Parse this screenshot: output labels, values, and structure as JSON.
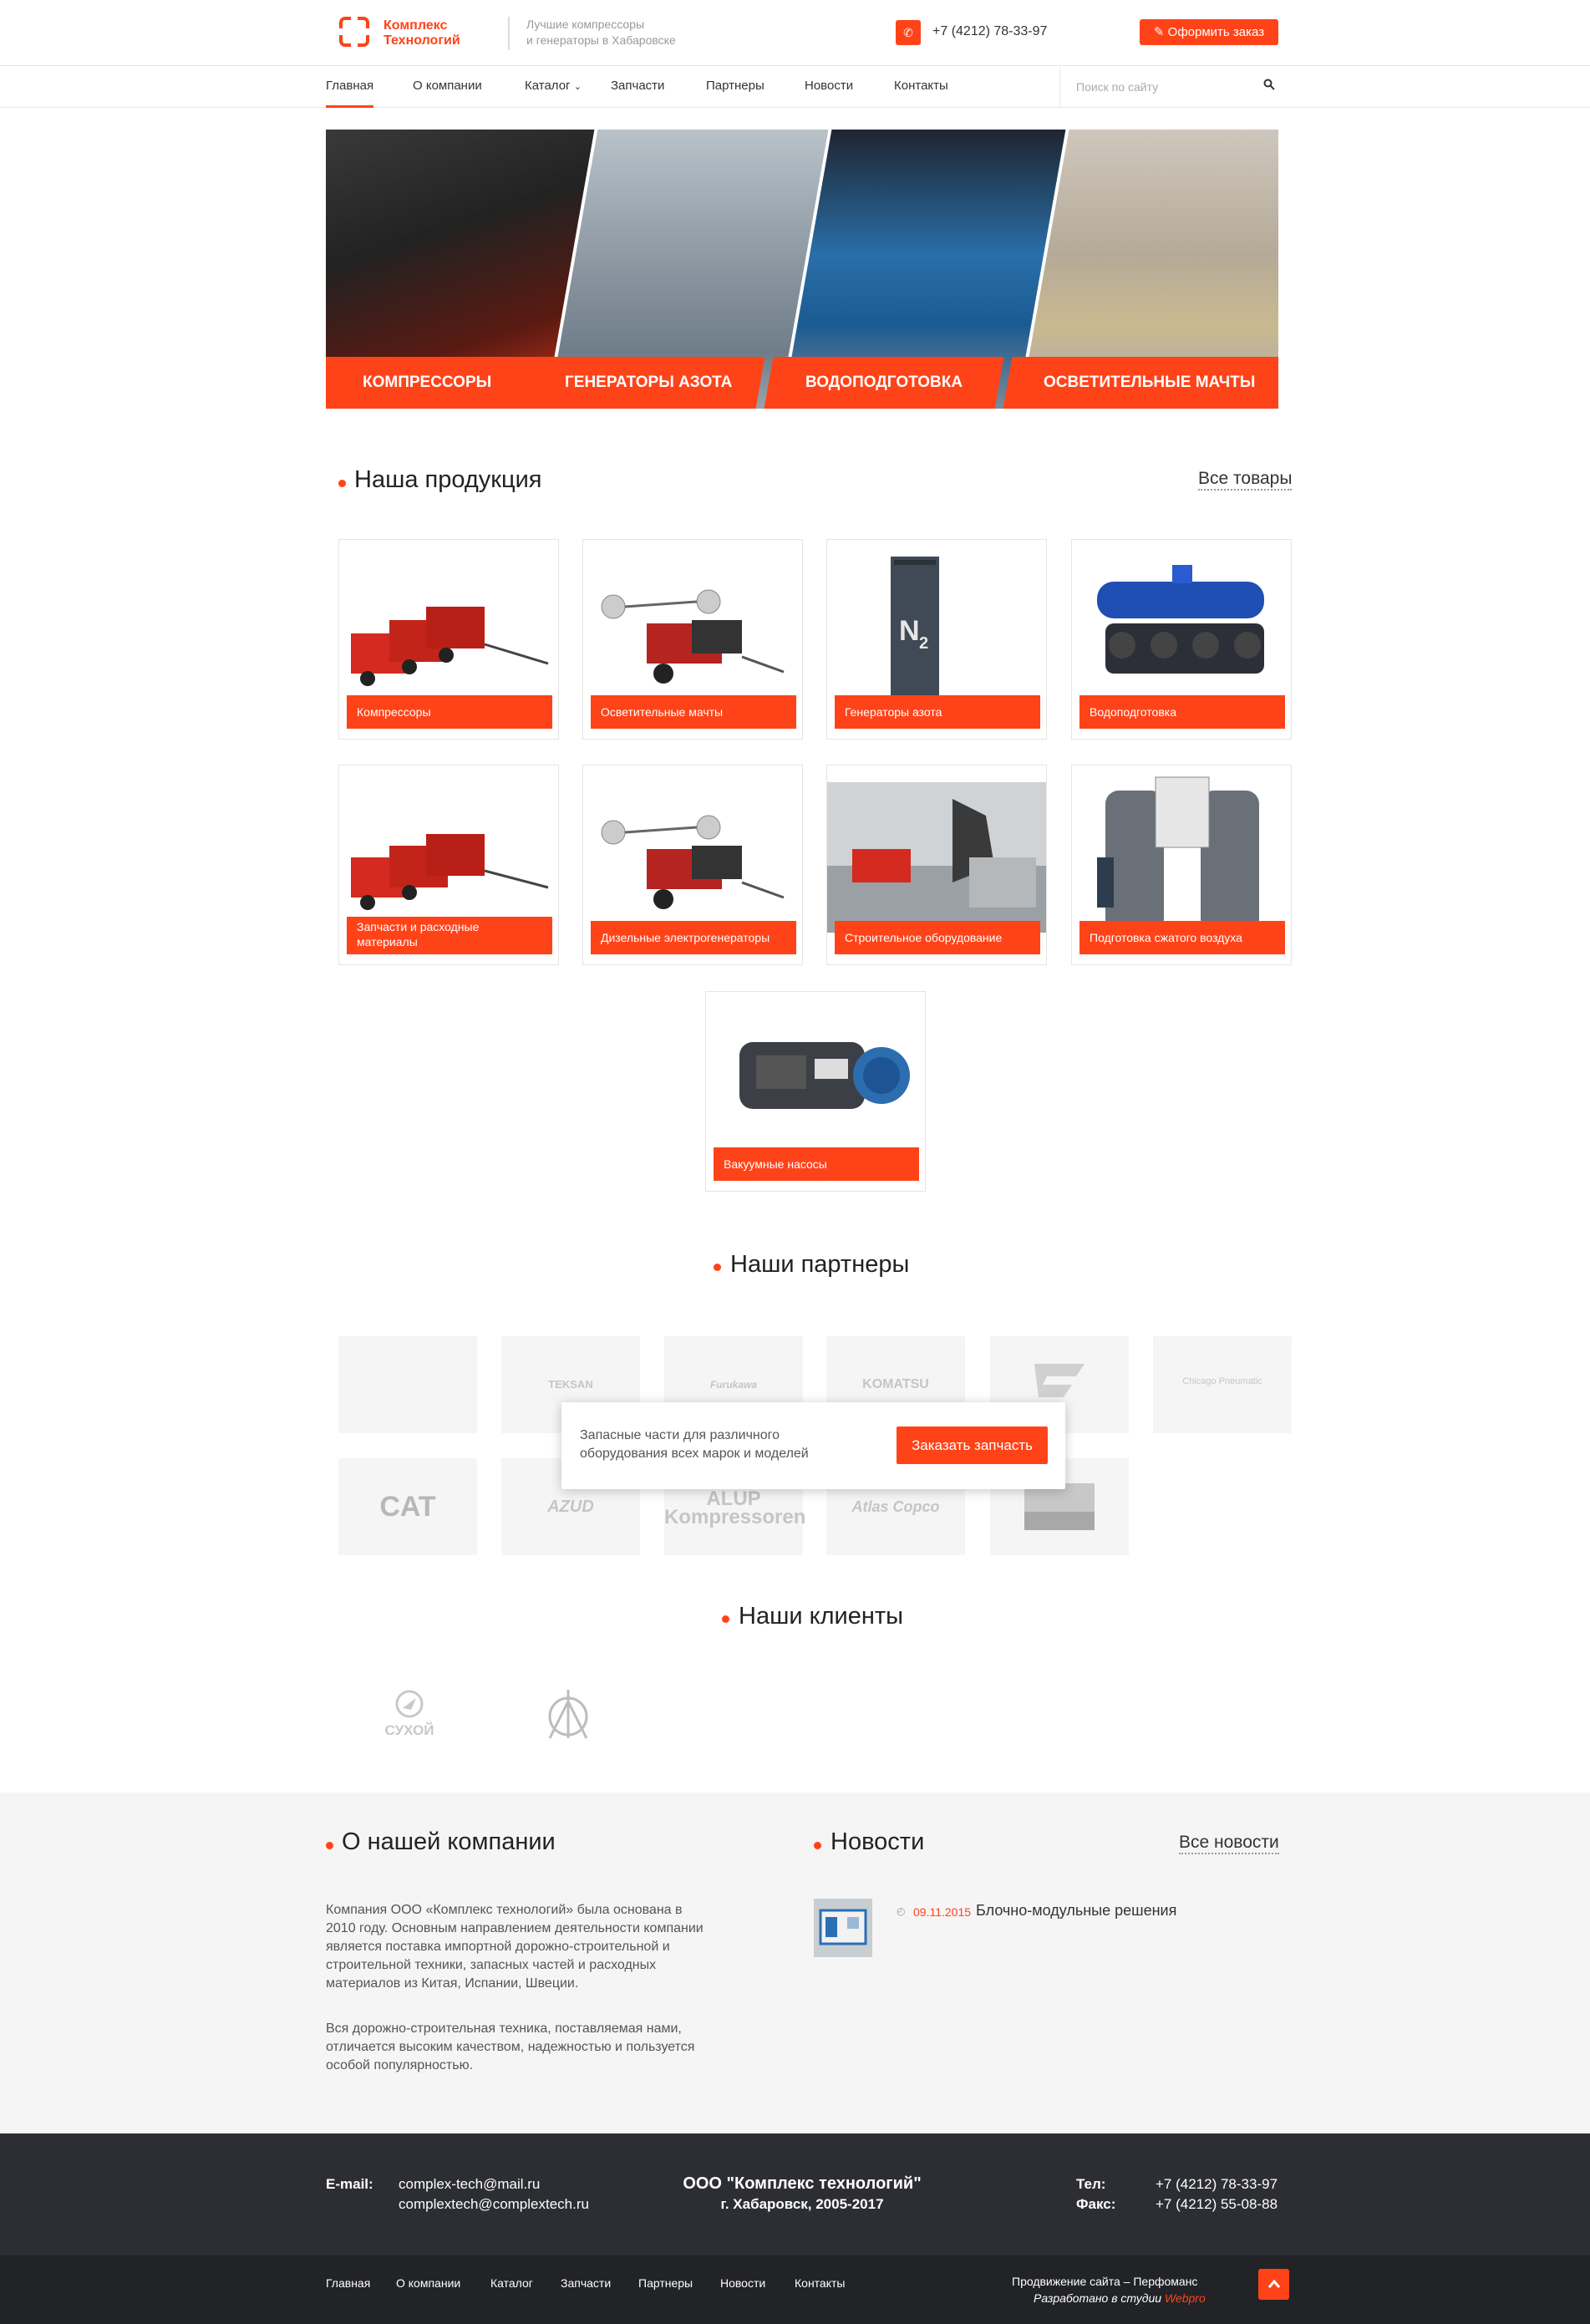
{
  "header": {
    "logo_line1": "Комплекс",
    "logo_line2": "Технологий",
    "slogan_line1": "Лучшие компрессоры",
    "slogan_line2": "и генераторы в Хабаровске",
    "phone": "+7 (4212) 78-33-97",
    "order_button": "Оформить заказ"
  },
  "nav": {
    "items": [
      "Главная",
      "О компании",
      "Каталог",
      "Запчасти",
      "Партнеры",
      "Новости",
      "Контакты"
    ],
    "search_placeholder": "Поиск по сайту"
  },
  "banner": {
    "items": [
      "КОМПРЕССОРЫ",
      "ГЕНЕРАТОРЫ АЗОТА",
      "ВОДОПОДГОТОВКА",
      "ОСВЕТИТЕЛЬНЫЕ МАЧТЫ"
    ]
  },
  "products": {
    "title": "Наша продукция",
    "all_link": "Все товары",
    "items": [
      "Компрессоры",
      "Осветительные мачты",
      "Генераторы азота",
      "Водоподготовка",
      "Запчасти и расходные материалы",
      "Дизельные электрогенераторы",
      "Строительное оборудование",
      "Подготовка сжатого воздуха",
      "Вакуумные насосы"
    ]
  },
  "partners": {
    "title": "Наши партнеры",
    "logos": [
      "TEKSAN",
      "Furukawa",
      "KOMATSU",
      "",
      "Chicago Pneumatic",
      "CAT",
      "AZUD",
      "ALUP Kompressoren",
      "Atlas Copco"
    ],
    "popup_text": "Запасные части для различного оборудования всех марок и моделей",
    "popup_button": "Заказать запчасть"
  },
  "clients": {
    "title": "Наши клиенты",
    "logos": [
      "СУХОЙ",
      "КНААЗ"
    ]
  },
  "about": {
    "title": "О нашей компании",
    "p1": "Компания ООО «Комплекс технологий» была основана в 2010 году. Основным направлением деятельности компании является поставка импортной дорожно-строительной и строительной техники, запасных частей и расходных материалов из Китая, Испании, Швеции.",
    "p2": "Вся дорожно-строительная техника, поставляемая нами, отличается высоким качеством, надежностью и пользуется особой популярностью."
  },
  "news": {
    "title": "Новости",
    "all_link": "Все новости",
    "items": [
      {
        "date": "09.11.2015",
        "title": "Блочно-модульные решения"
      }
    ]
  },
  "footer": {
    "email_label": "E-mail:",
    "email1": "complex-tech@mail.ru",
    "email2": "complextech@complextech.ru",
    "company": "ООО \"Комплекс технологий\"",
    "city": "г. Хабаровск, 2005-2017",
    "tel_label": "Тел:",
    "tel": "+7 (4212) 78-33-97",
    "fax_label": "Факс:",
    "fax": "+7 (4212) 55-08-88",
    "nav": [
      "Главная",
      "О компании",
      "Каталог",
      "Запчасти",
      "Партнеры",
      "Новости",
      "Контакты"
    ],
    "promo": "Продвижение сайта – Перфоманс",
    "dev_prefix": "Разработано в студии",
    "dev_studio": "Webpro"
  },
  "colors": {
    "accent": "#ff4319",
    "footer_bg": "#2d2e33",
    "grey_bg": "#f5f5f5"
  },
  "icons": [
    "logo-icon",
    "phone-icon",
    "pencil-icon",
    "chevron-down-icon",
    "search-icon",
    "clock-icon",
    "arrow-up-icon"
  ]
}
